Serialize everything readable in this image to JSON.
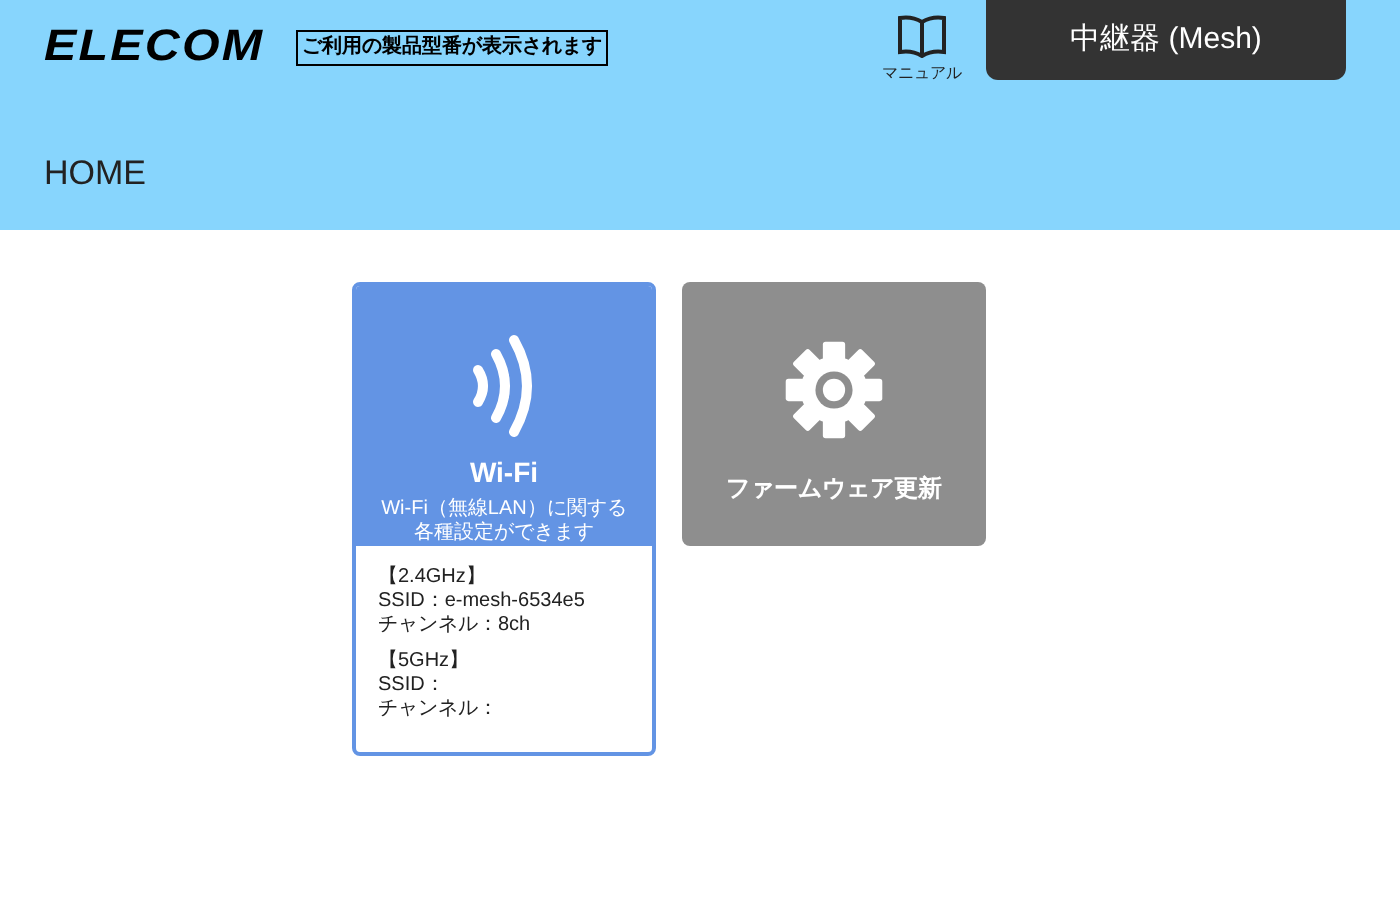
{
  "header": {
    "logo": "ELECOM",
    "model_label": "ご利用の製品型番が表示されます",
    "manual": {
      "label": "マニュアル"
    },
    "mode": "中継器 (Mesh)"
  },
  "page_title": "HOME",
  "tiles": [
    {
      "kind": "wifi",
      "title": "Wi-Fi",
      "description": [
        "Wi-Fi（無線LAN）に関する",
        "各種設定ができます"
      ],
      "bands": [
        {
          "heading": "【2.4GHz】",
          "lines": [
            "SSID：e-mesh-6534e5",
            "チャンネル：8ch"
          ]
        },
        {
          "heading": "【5GHz】",
          "lines": [
            "SSID：",
            "チャンネル："
          ]
        }
      ]
    },
    {
      "kind": "firmware",
      "title": "ファームウェア更新"
    }
  ]
}
